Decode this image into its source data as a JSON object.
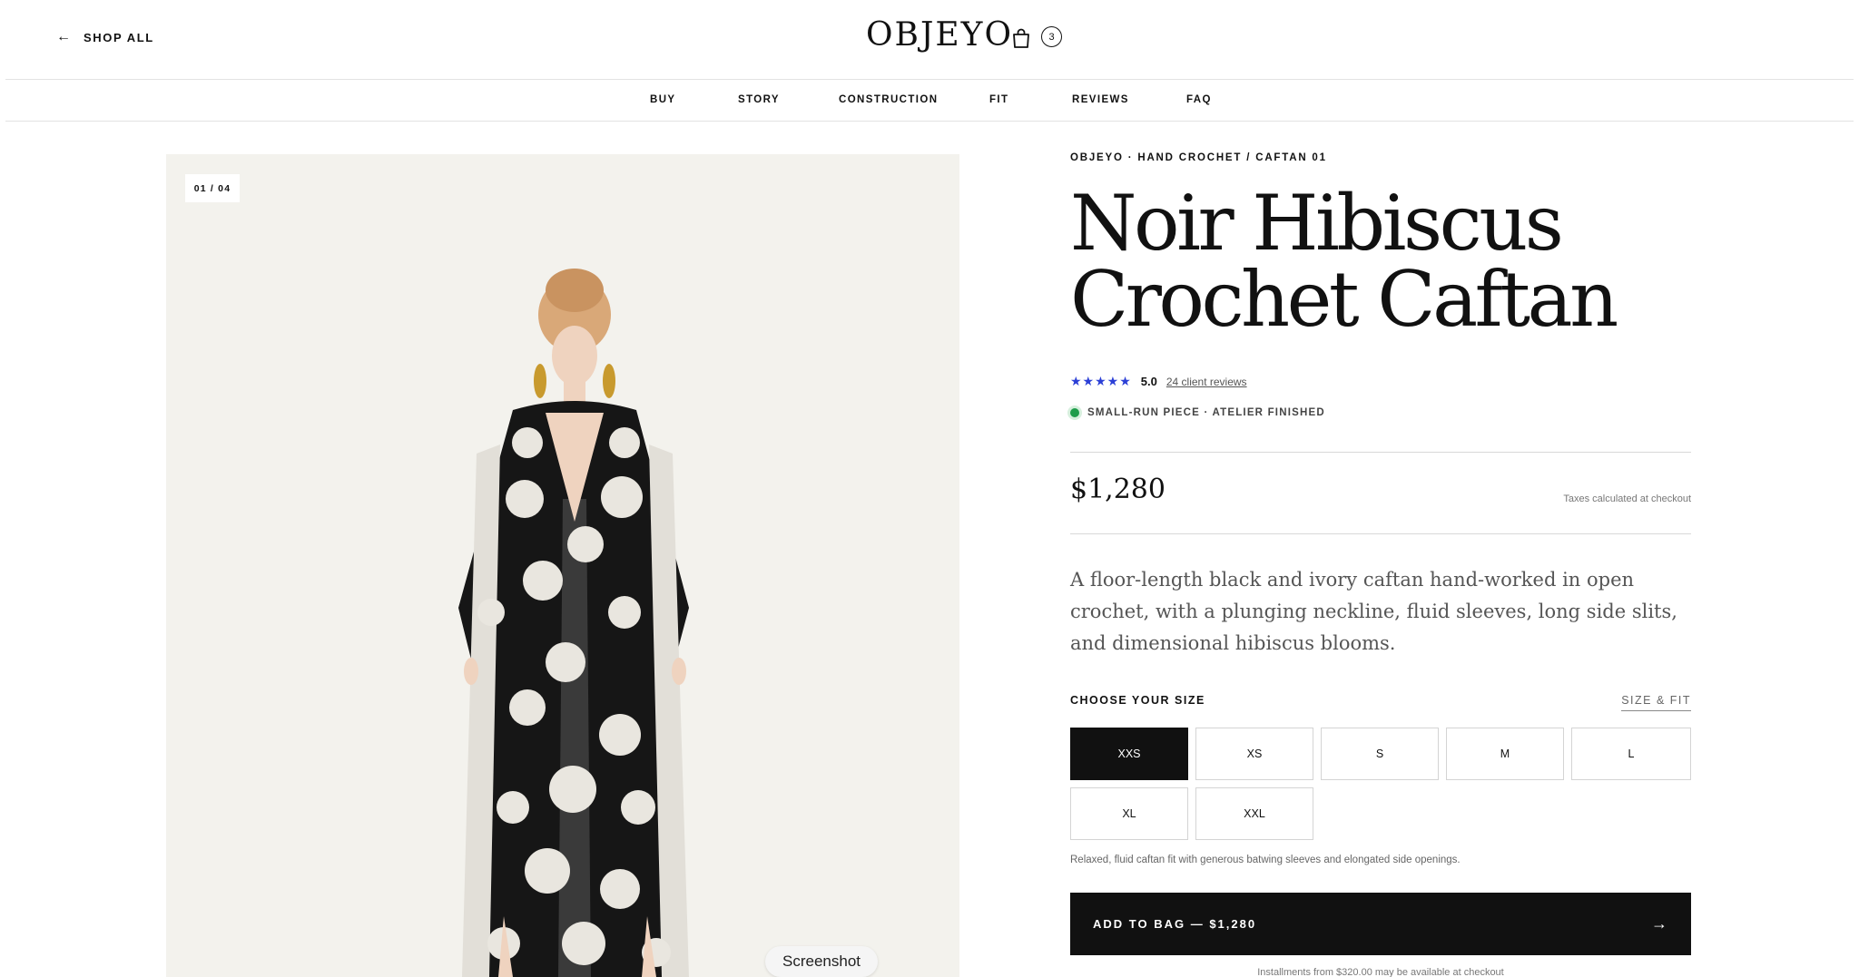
{
  "header": {
    "back_label": "SHOP ALL",
    "logo": "OBJEYO",
    "bag_count": "3"
  },
  "subnav": [
    "BUY",
    "STORY",
    "CONSTRUCTION",
    "FIT",
    "REVIEWS",
    "FAQ"
  ],
  "gallery": {
    "counter": "01 / 04"
  },
  "product": {
    "eyebrow": "OBJEYO · HAND CROCHET / CAFTAN 01",
    "title_line1": "Noir Hibiscus",
    "title_line2": "Crochet Caftan",
    "stars": "★★★★★",
    "rating": "5.0",
    "reviews_link": "24 client reviews",
    "status": "SMALL-RUN PIECE · ATELIER FINISHED",
    "price": "$1,280",
    "tax_note": "Taxes calculated at checkout",
    "description": "A floor-length black and ivory caftan hand-worked in open crochet, with a plunging neckline, fluid sleeves, long side slits, and dimensional hibiscus blooms.",
    "size_label": "CHOOSE YOUR SIZE",
    "size_fit_link": "SIZE & FIT",
    "sizes": [
      "XXS",
      "XS",
      "S",
      "M",
      "L",
      "XL",
      "XXL"
    ],
    "selected_size": "XXS",
    "fit_note": "Relaxed, fluid caftan fit with generous batwing sleeves and elongated side openings.",
    "add_to_bag": "ADD TO BAG — $1,280",
    "installments": "Installments from $320.00 may be available at checkout"
  },
  "overlay": {
    "screenshot_label": "Screenshot"
  },
  "colors": {
    "accent_star": "#2b3fd6",
    "status_dot": "#1f9d4b",
    "gallery_bg": "#f3f2ed",
    "button_bg": "#111111"
  }
}
